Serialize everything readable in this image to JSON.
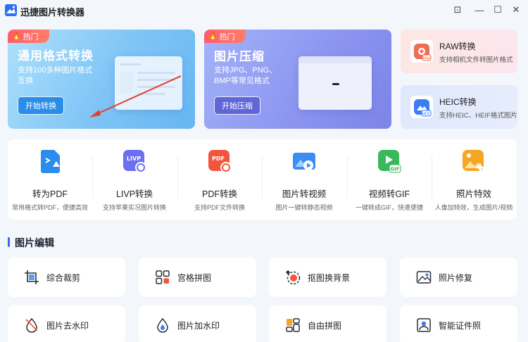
{
  "window": {
    "title": "迅捷图片转换器",
    "controls": [
      "⊡",
      "—",
      "☐",
      "✕"
    ]
  },
  "hero_cards": [
    {
      "tag": "热门",
      "title": "通用格式转换",
      "description": "支持100多种图片格式互换",
      "button": "开始转换",
      "accent": "#2a8ee8"
    },
    {
      "tag": "热门",
      "title": "图片压缩",
      "description": "支持JPG、PNG、BMP等常见格式",
      "button": "开始压缩",
      "accent": "#5f66d8"
    }
  ],
  "side_cards": [
    {
      "title": "RAW转换",
      "description": "支持相机文件转图片格式",
      "icon": "camera-raw-icon",
      "color": "#f26b52"
    },
    {
      "title": "HEIC转换",
      "description": "支持HEIC、HEIF格式图片",
      "icon": "heic-icon",
      "color": "#3d7cf2"
    }
  ],
  "tools": [
    {
      "title": "转为PDF",
      "description": "常用格式转PDF，便捷高效",
      "icon": "to-pdf-icon",
      "color": "#2b8cf0"
    },
    {
      "title": "LIVP转换",
      "description": "支持苹果实况图片转换",
      "icon": "livp-icon",
      "color": "#6b6ff0"
    },
    {
      "title": "PDF转换",
      "description": "支持PDF文件转换",
      "icon": "pdf-convert-icon",
      "color": "#f2553f"
    },
    {
      "title": "图片转视频",
      "description": "图片一键转静态视频",
      "icon": "image-to-video-icon",
      "color": "#3a8ef2"
    },
    {
      "title": "视频转GIF",
      "description": "一键转成GIF，快速便捷",
      "icon": "video-to-gif-icon",
      "color": "#39b95a"
    },
    {
      "title": "照片特效",
      "description": "人像加特效，生成图片/视频",
      "icon": "photo-effects-icon",
      "color": "#f5a623"
    }
  ],
  "section": {
    "title": "图片编辑",
    "accent": "#2b6ff5"
  },
  "edit_items": [
    {
      "label": "综合裁剪",
      "icon": "crop-icon"
    },
    {
      "label": "宫格拼图",
      "icon": "grid-collage-icon"
    },
    {
      "label": "抠图换背景",
      "icon": "cutout-background-icon"
    },
    {
      "label": "照片修复",
      "icon": "photo-repair-icon"
    },
    {
      "label": "图片去水印",
      "icon": "remove-watermark-icon"
    },
    {
      "label": "图片加水印",
      "icon": "add-watermark-icon"
    },
    {
      "label": "自由拼图",
      "icon": "free-collage-icon"
    },
    {
      "label": "智能证件照",
      "icon": "id-photo-icon"
    }
  ]
}
